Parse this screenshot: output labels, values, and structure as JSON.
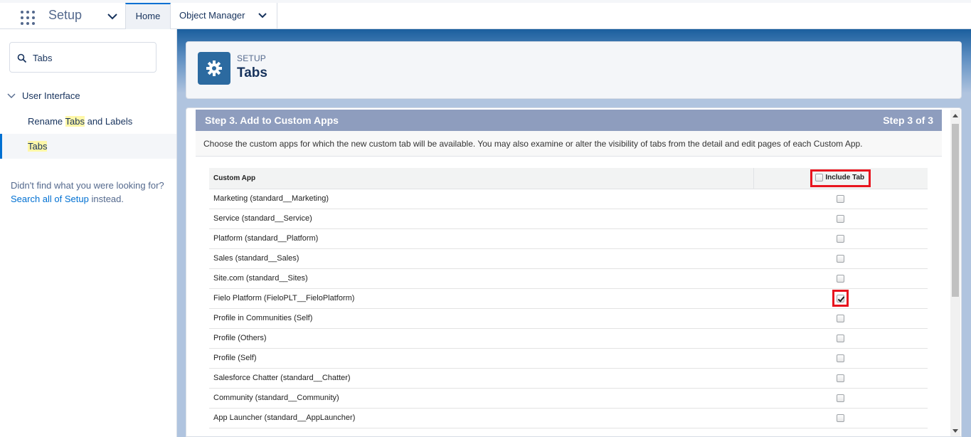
{
  "topnav": {
    "app_name": "Setup",
    "tabs": [
      {
        "label": "Home"
      },
      {
        "label": "Object Manager"
      }
    ]
  },
  "sidebar": {
    "search_value": "Tabs",
    "tree_parent": "User Interface",
    "items": [
      {
        "before": "Rename ",
        "highlight": "Tabs",
        "after": " and Labels"
      },
      {
        "before": "",
        "highlight": "Tabs",
        "after": ""
      }
    ],
    "not_found_text": "Didn't find what you were looking for?",
    "not_found_link": "Search all of Setup",
    "not_found_suffix": " instead."
  },
  "header": {
    "small": "SETUP",
    "title": "Tabs",
    "icon": "gear-icon"
  },
  "wizard": {
    "step_title": "Step 3. Add to Custom Apps",
    "step_counter": "Step 3 of 3",
    "instructions": "Choose the custom apps for which the new custom tab will be available. You may also examine or alter the visibility of tabs from the detail and edit pages of each Custom App.",
    "col_app": "Custom App",
    "col_include": "Include Tab",
    "include_all_checked": false,
    "rows": [
      {
        "app": "Marketing (standard__Marketing)",
        "checked": false
      },
      {
        "app": "Service (standard__Service)",
        "checked": false
      },
      {
        "app": "Platform (standard__Platform)",
        "checked": false
      },
      {
        "app": "Sales (standard__Sales)",
        "checked": false
      },
      {
        "app": "Site.com (standard__Sites)",
        "checked": false
      },
      {
        "app": "Fielo Platform (FieloPLT__FieloPlatform)",
        "checked": true
      },
      {
        "app": "Profile in Communities (Self)",
        "checked": false
      },
      {
        "app": "Profile (Others)",
        "checked": false
      },
      {
        "app": "Profile (Self)",
        "checked": false
      },
      {
        "app": "Salesforce Chatter (standard__Chatter)",
        "checked": false
      },
      {
        "app": "Community (standard__Community)",
        "checked": false
      },
      {
        "app": "App Launcher (standard__AppLauncher)",
        "checked": false
      }
    ]
  },
  "colors": {
    "accent": "#0070d2",
    "header_icon_bg": "#2c6aa0",
    "step_bar": "#8e9dbe",
    "annotation_red": "#e8141e"
  }
}
